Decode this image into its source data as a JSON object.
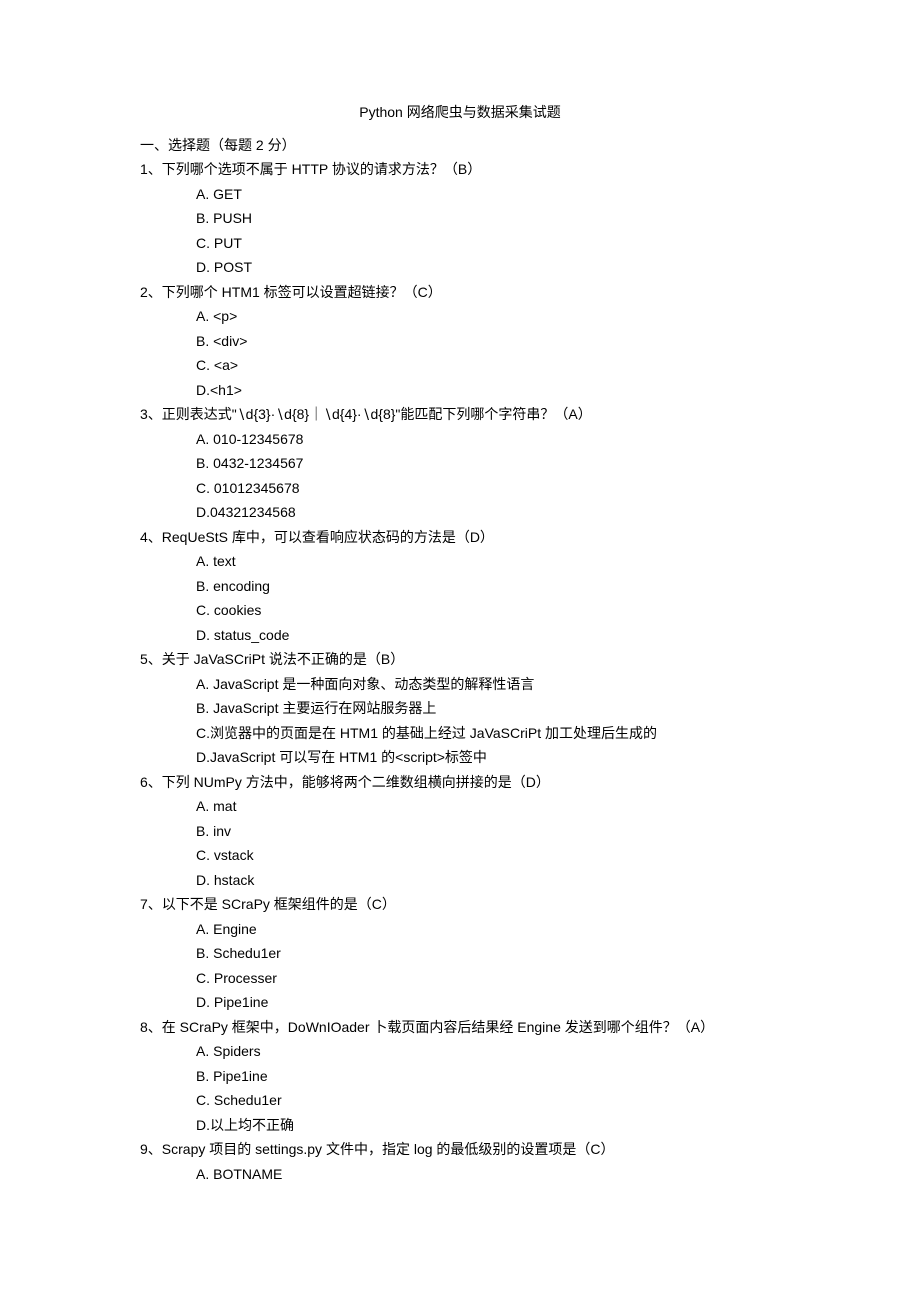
{
  "title": "Python 网络爬虫与数据采集试题",
  "section1_title": "一、选择题（每题 2 分）",
  "q1": {
    "stem": "1、下列哪个选项不属于 HTTP 协议的请求方法？（B）",
    "A": "A.   GET",
    "B": "B.   PUSH",
    "C": "C.   PUT",
    "D": "D.   POST"
  },
  "q2": {
    "stem": "2、下列哪个 HTM1 标签可以设置超链接？（C）",
    "A": "A.   <p>",
    "B": "B.   <div>",
    "C": "C.   <a>",
    "D": "D.<h1>"
  },
  "q3": {
    "stem": "3、正则表达式\"∖d{3}·∖d{8}｜∖d{4}·∖d{8}\"能匹配下列哪个字符串？（A）",
    "A": "A.   010-12345678",
    "B": "B.   0432-1234567",
    "C": "C.   01012345678",
    "D": "D.04321234568"
  },
  "q4": {
    "stem": "4、ReqUeStS 库中，可以查看响应状态码的方法是（D）",
    "A": "A.   text",
    "B": "B.   encoding",
    "C": "C.   cookies",
    "D": "D.   status_code"
  },
  "q5": {
    "stem": "5、关于 JaVaSCriPt 说法不正确的是（B）",
    "A": "A.   JavaScript 是一种面向对象、动态类型的解释性语言",
    "B": "B.   JavaScript 主要运行在网站服务器上",
    "C": "C.浏览器中的页面是在 HTM1 的基础上经过 JaVaSCriPt 加工处理后生成的",
    "D": "D.JavaScript 可以写在 HTM1 的<script>标签中"
  },
  "q6": {
    "stem": "6、下列 NUmPy 方法中，能够将两个二维数组横向拼接的是（D）",
    "A": "A.   mat",
    "B": "B.   inv",
    "C": "C.   vstack",
    "D": "D.   hstack"
  },
  "q7": {
    "stem": "7、以下不是 SCraPy 框架组件的是（C）",
    "A": "A.   Engine",
    "B": "B.   Schedu1er",
    "C": "C.   Processer",
    "D": "D.   Pipe1ine"
  },
  "q8": {
    "stem": "8、在 SCraPy 框架中，DoWnIOader 卜载页面内容后结果经 Engine 发送到哪个组件？（A）",
    "A": "A.   Spiders",
    "B": "B.   Pipe1ine",
    "C": "C.   Schedu1er",
    "D": "D.以上均不正确"
  },
  "q9": {
    "stem": "9、Scrapy 项目的 settings.py 文件中，指定 log 的最低级别的设置项是（C）",
    "A": "A.   BOTNAME"
  }
}
